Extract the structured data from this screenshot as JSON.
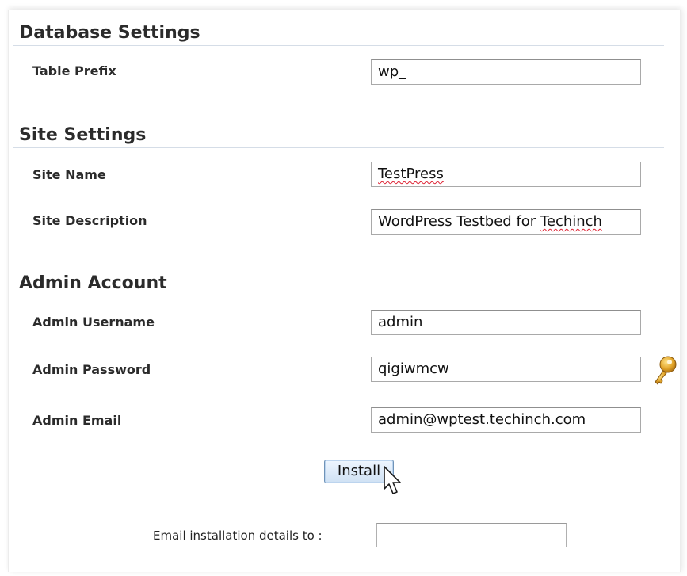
{
  "sections": {
    "database": {
      "title": "Database Settings",
      "table_prefix": {
        "label": "Table Prefix",
        "value": "wp_"
      }
    },
    "site": {
      "title": "Site Settings",
      "site_name": {
        "label": "Site Name",
        "value": "TestPress"
      },
      "site_description": {
        "label": "Site Description",
        "value_start": "WordPress Testbed for ",
        "value_end": "Techinch"
      }
    },
    "admin": {
      "title": "Admin Account",
      "username": {
        "label": "Admin Username",
        "value": "admin"
      },
      "password": {
        "label": "Admin Password",
        "value": "qigiwmcw"
      },
      "email": {
        "label": "Admin Email",
        "value": "admin@wptest.techinch.com"
      }
    }
  },
  "install_button": {
    "label": "Install"
  },
  "email_details": {
    "label": "Email installation details to :",
    "value": ""
  },
  "icons": {
    "password_generator": "key-icon",
    "pointer": "mouse-cursor-icon"
  }
}
